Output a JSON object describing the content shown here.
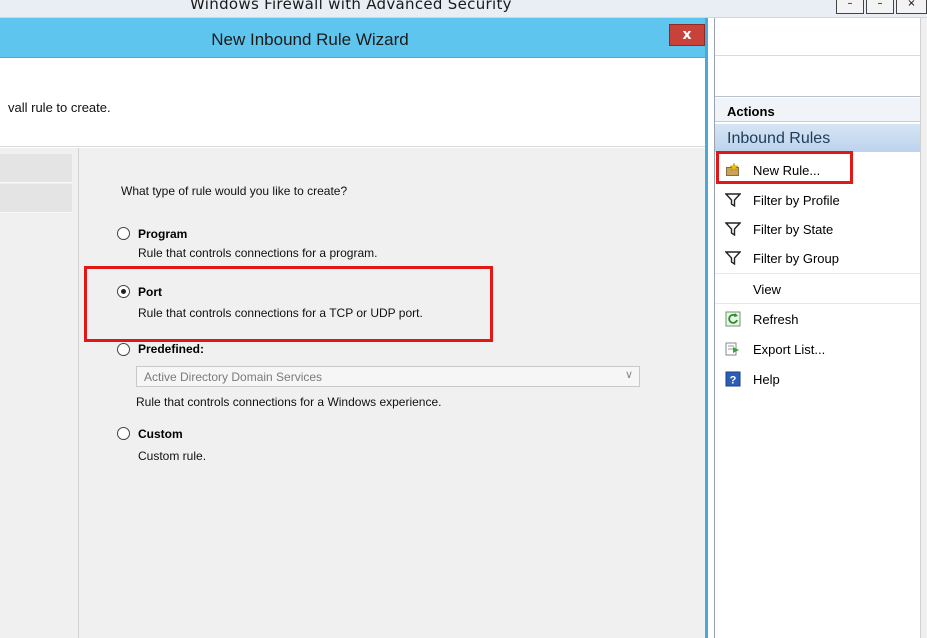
{
  "background_window": {
    "title": "Windows Firewall with Advanced Security",
    "controls": [
      "–",
      "–",
      "×"
    ]
  },
  "wizard": {
    "title": "New Inbound Rule Wizard",
    "close_glyph": "x",
    "header_text": "vall rule to create.",
    "question": "What type of rule would you like to create?",
    "options": [
      {
        "label": "Program",
        "description": "Rule that controls connections for a program.",
        "selected": false
      },
      {
        "label": "Port",
        "description": "Rule that controls connections for a TCP or UDP port.",
        "selected": true
      },
      {
        "label": "Predefined:",
        "description": "Rule that controls connections for a Windows experience.",
        "selected": false,
        "select_value": "Active Directory Domain Services"
      },
      {
        "label": "Custom",
        "description": "Custom rule.",
        "selected": false
      }
    ]
  },
  "actions_pane": {
    "header": "Actions",
    "section": "Inbound Rules",
    "items": [
      {
        "label": "New Rule...",
        "icon": "new-rule-icon"
      },
      {
        "label": "Filter by Profile",
        "icon": "filter-icon"
      },
      {
        "label": "Filter by State",
        "icon": "filter-icon"
      },
      {
        "label": "Filter by Group",
        "icon": "filter-icon"
      },
      {
        "label": "View",
        "icon": ""
      },
      {
        "label": "Refresh",
        "icon": "refresh-icon"
      },
      {
        "label": "Export List...",
        "icon": "export-icon"
      },
      {
        "label": "Help",
        "icon": "help-icon"
      }
    ]
  },
  "colors": {
    "wizard_titlebar": "#5ec6ee",
    "highlight": "#e01818",
    "section_band": "#c8dbf0"
  }
}
